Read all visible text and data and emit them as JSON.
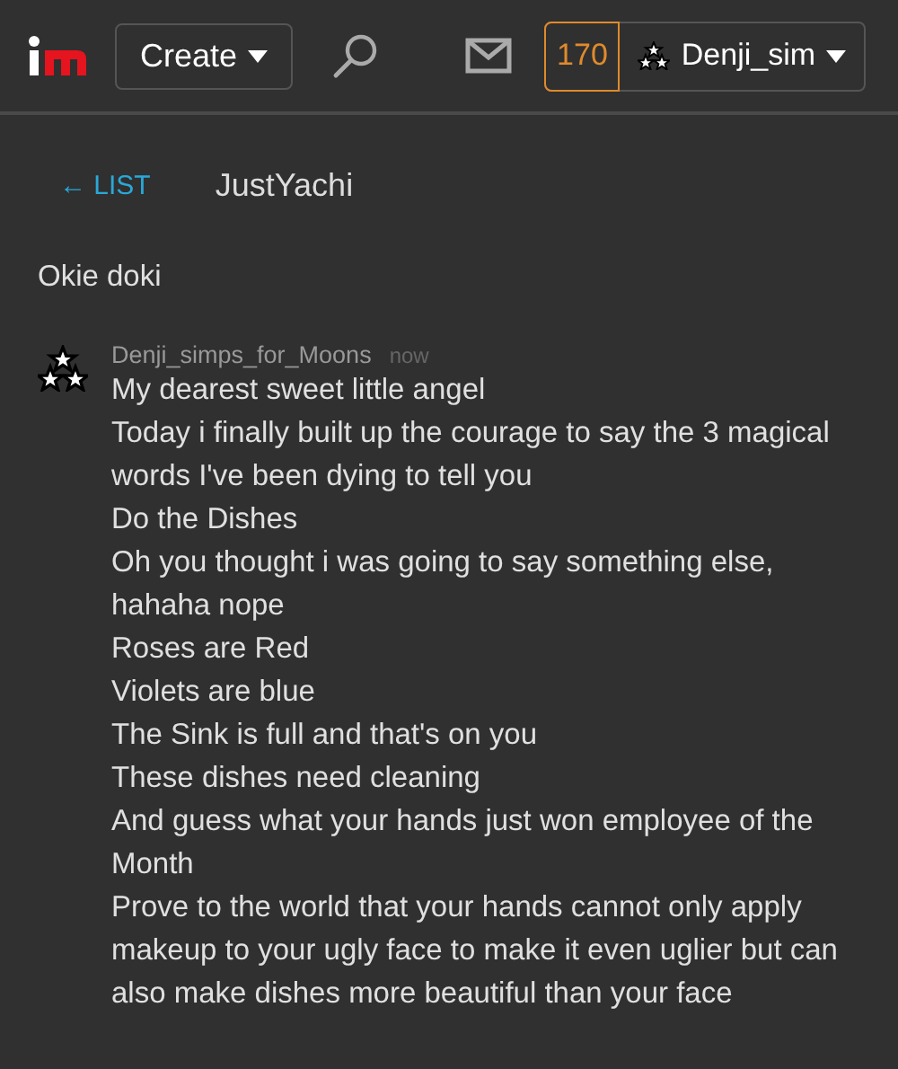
{
  "header": {
    "create_label": "Create",
    "points": "170",
    "username": "Denji_sim"
  },
  "nav": {
    "back_label": "← LIST",
    "conversation_title": "JustYachi"
  },
  "messages": [
    {
      "text_lines": [
        "Okie doki"
      ]
    },
    {
      "author": "Denji_simps_for_Moons",
      "time": "now",
      "text_lines": [
        "My dearest sweet little angel",
        "Today i finally built up the courage to say the 3 magical words I've been dying to tell you",
        "Do the Dishes",
        "Oh you thought i was going to say something else, hahaha nope",
        "Roses are Red",
        "Violets are blue",
        "The Sink is full and that's on you",
        "These dishes need cleaning",
        "And guess what your hands just won employee of the Month",
        "Prove to the world that your hands cannot only apply makeup to your ugly face to make it even uglier but can also make dishes more beautiful than your face"
      ]
    }
  ]
}
